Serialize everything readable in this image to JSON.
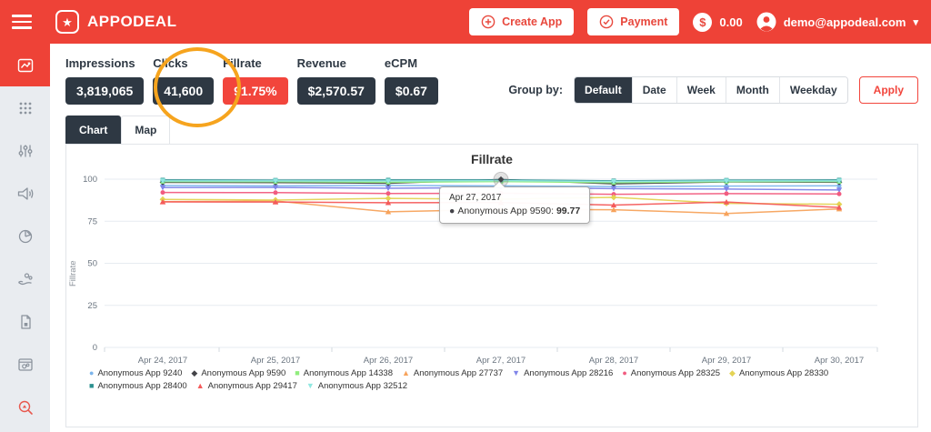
{
  "header": {
    "brand": "APPODEAL",
    "create_app_label": "Create App",
    "payment_label": "Payment",
    "currency_symbol": "$",
    "balance": "0.00",
    "user_email": "demo@appodeal.com"
  },
  "icons": {
    "star": "★",
    "caret_down": "▾",
    "tooltip_marker": "●"
  },
  "sidebar": {
    "icons": [
      {
        "name": "line-chart-icon",
        "active": true
      },
      {
        "name": "apps-grid-icon",
        "active": false
      },
      {
        "name": "sliders-icon",
        "active": false
      },
      {
        "name": "megaphone-icon",
        "active": false
      },
      {
        "name": "pie-chart-icon",
        "active": false
      },
      {
        "name": "monetization-hand-icon",
        "active": false
      },
      {
        "name": "document-icon",
        "active": false
      },
      {
        "name": "app-gears-icon",
        "active": false
      },
      {
        "name": "search-analytics-icon",
        "active": false
      }
    ]
  },
  "stats": {
    "items": [
      {
        "label": "Impressions",
        "value": "3,819,065",
        "highlight": false
      },
      {
        "label": "Clicks",
        "value": "41,600",
        "highlight": false
      },
      {
        "label": "Fillrate",
        "value": "91.75%",
        "highlight": true
      },
      {
        "label": "Revenue",
        "value": "$2,570.57",
        "highlight": false
      },
      {
        "label": "eCPM",
        "value": "$0.67",
        "highlight": false
      }
    ],
    "highlight_annotation_color": "#f6a41e"
  },
  "group_by": {
    "label": "Group by:",
    "options": [
      "Default",
      "Date",
      "Week",
      "Month",
      "Weekday"
    ],
    "selected": "Default",
    "apply_label": "Apply"
  },
  "tabs": [
    {
      "label": "Chart",
      "active": true
    },
    {
      "label": "Map",
      "active": false
    }
  ],
  "chart_data": {
    "type": "line",
    "title": "Fillrate",
    "ylabel": "Fillrate",
    "ylim": [
      0,
      100
    ],
    "yticks": [
      0,
      25,
      50,
      75,
      100
    ],
    "grid": true,
    "legend_position": "bottom",
    "categories": [
      "Apr 24, 2017",
      "Apr 25, 2017",
      "Apr 26, 2017",
      "Apr 27, 2017",
      "Apr 28, 2017",
      "Apr 29, 2017",
      "Apr 30, 2017"
    ],
    "series": [
      {
        "name": "Anonymous App 9240",
        "color": "#7cb5ec",
        "values": [
          96.2,
          96.0,
          96.3,
          96.0,
          95.6,
          95.9,
          96.1
        ]
      },
      {
        "name": "Anonymous App 9590",
        "color": "#434348",
        "values": [
          98.1,
          98.0,
          97.6,
          99.77,
          97.2,
          98.4,
          98.2
        ]
      },
      {
        "name": "Anonymous App 14338",
        "color": "#90ed7d",
        "values": [
          98.6,
          98.5,
          98.2,
          98.6,
          98.0,
          98.5,
          98.6
        ]
      },
      {
        "name": "Anonymous App 27737",
        "color": "#f7a35c",
        "values": [
          86.6,
          87.0,
          80.6,
          82.0,
          81.8,
          79.6,
          82.3
        ]
      },
      {
        "name": "Anonymous App 28216",
        "color": "#8085e9",
        "values": [
          95.0,
          95.1,
          94.6,
          95.0,
          94.4,
          94.1,
          93.6
        ]
      },
      {
        "name": "Anonymous App 28325",
        "color": "#f15c80",
        "values": [
          92.1,
          92.0,
          91.5,
          91.6,
          91.0,
          91.4,
          91.2
        ]
      },
      {
        "name": "Anonymous App 28330",
        "color": "#e4d354",
        "values": [
          88.0,
          87.6,
          88.6,
          88.1,
          89.2,
          85.6,
          85.1
        ]
      },
      {
        "name": "Anonymous App 28400",
        "color": "#2b908f",
        "values": [
          99.5,
          99.4,
          99.5,
          99.5,
          99.0,
          99.4,
          99.5
        ]
      },
      {
        "name": "Anonymous App 29417",
        "color": "#f45b5b",
        "values": [
          86.5,
          86.4,
          86.0,
          86.1,
          84.6,
          86.4,
          83.2
        ]
      },
      {
        "name": "Anonymous App 32512",
        "color": "#91e8e1",
        "values": [
          99.0,
          99.0,
          98.9,
          99.1,
          98.6,
          99.0,
          99.0
        ]
      }
    ],
    "tooltip": {
      "date": "Apr 27, 2017",
      "series_name": "Anonymous App 9590",
      "series_label": "Anonymous App 9590:",
      "value": "99.77",
      "series_color": "#434348",
      "category_index": 3
    }
  }
}
